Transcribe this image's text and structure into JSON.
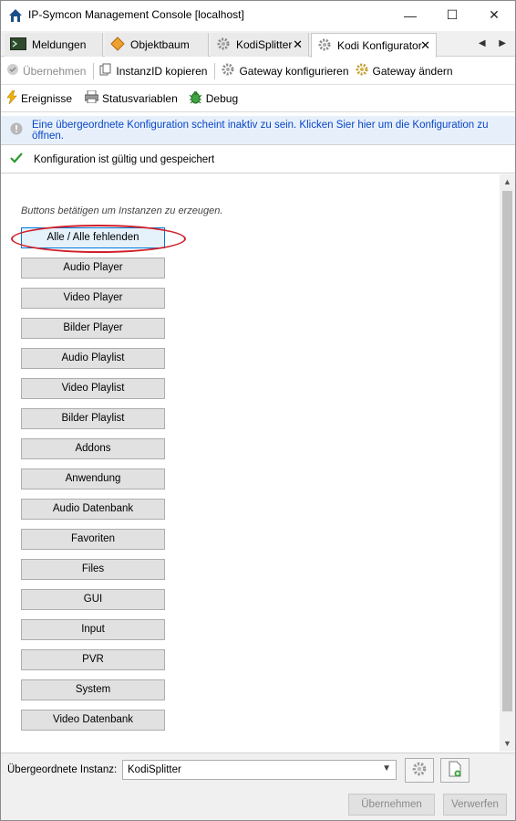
{
  "window": {
    "title": "IP-Symcon Management Console [localhost]",
    "min_glyph": "—",
    "max_glyph": "☐",
    "close_glyph": "✕"
  },
  "tabs": [
    {
      "label": "Meldungen",
      "icon": "console-icon",
      "active": false
    },
    {
      "label": "Objektbaum",
      "icon": "diamond-icon",
      "active": false
    },
    {
      "label": "KodiSplitter",
      "icon": "gear-icon",
      "active": false
    },
    {
      "label": "Kodi Konfigurator",
      "icon": "gear-icon",
      "active": true
    }
  ],
  "tab_close_glyph": "✕",
  "tab_scroll_glyph": "◀ ▶",
  "toolbar1": {
    "apply_label": "Übernehmen",
    "copy_id_label": "InstanzID kopieren",
    "configure_gateway_label": "Gateway konfigurieren",
    "change_gateway_label": "Gateway ändern"
  },
  "toolbar2": {
    "events_label": "Ereignisse",
    "status_vars_label": "Statusvariablen",
    "debug_label": "Debug"
  },
  "info_message": "Eine übergeordnete Konfiguration scheint inaktiv zu sein. Klicken Sier hier um die Konfiguration zu öffnen.",
  "ok_message": "Konfiguration ist gültig und gespeichert",
  "main": {
    "hint": "Buttons betätigen um Instanzen zu erzeugen.",
    "buttons": [
      "Alle / Alle fehlenden",
      "Audio Player",
      "Video Player",
      "Bilder Player",
      "Audio Playlist",
      "Video Playlist",
      "Bilder Playlist",
      "Addons",
      "Anwendung",
      "Audio Datenbank",
      "Favoriten",
      "Files",
      "GUI",
      "Input",
      "PVR",
      "System",
      "Video Datenbank"
    ],
    "highlight_color": "#d0202a"
  },
  "footer": {
    "parent_label": "Übergeordnete Instanz:",
    "parent_value": "KodiSplitter",
    "apply_label": "Übernehmen",
    "discard_label": "Verwerfen"
  },
  "colors": {
    "info_text": "#0a46c8",
    "info_bg": "#e7f0fa",
    "ok_check": "#2e9a2e",
    "annotation": "#d0202a"
  }
}
